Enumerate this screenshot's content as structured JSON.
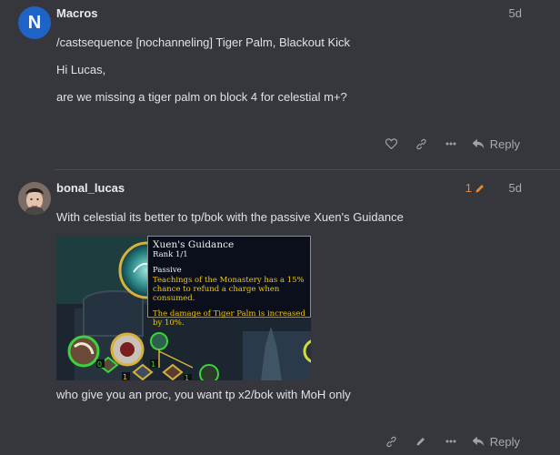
{
  "post1": {
    "avatar_letter": "N",
    "username": "Macros",
    "date": "5d",
    "lines": [
      "/castsequence [nochanneling] Tiger Palm, Blackout Kick",
      "Hi Lucas,",
      "are we missing a tiger palm on block 4 for celestial m+?"
    ],
    "reply_label": "Reply"
  },
  "post2": {
    "username": "bonal_lucas",
    "edit_count": "1",
    "date": "5d",
    "line1": "With celestial its better to tp/bok with the passive Xuen's Guidance",
    "line2": "who give you an proc, you want tp x2/bok with MoH only",
    "reply_label": "Reply",
    "tooltip": {
      "title": "Xuen's Guidance",
      "rank": "Rank 1/1",
      "type": "Passive",
      "desc1": "Teachings of the Monastery has a 15% chance to refund a charge when consumed.",
      "desc2": "The damage of Tiger Palm is increased by 10%."
    },
    "badges": [
      "0",
      "1",
      "1",
      "1"
    ]
  },
  "colors": {
    "background": "#35373d",
    "accent_orange": "#e8892d",
    "avatar_blue": "#1e64c8",
    "tooltip_yellow": "#f2c800"
  },
  "icons": [
    "heart-icon",
    "link-icon",
    "more-icon",
    "reply-icon",
    "pencil-icon"
  ]
}
